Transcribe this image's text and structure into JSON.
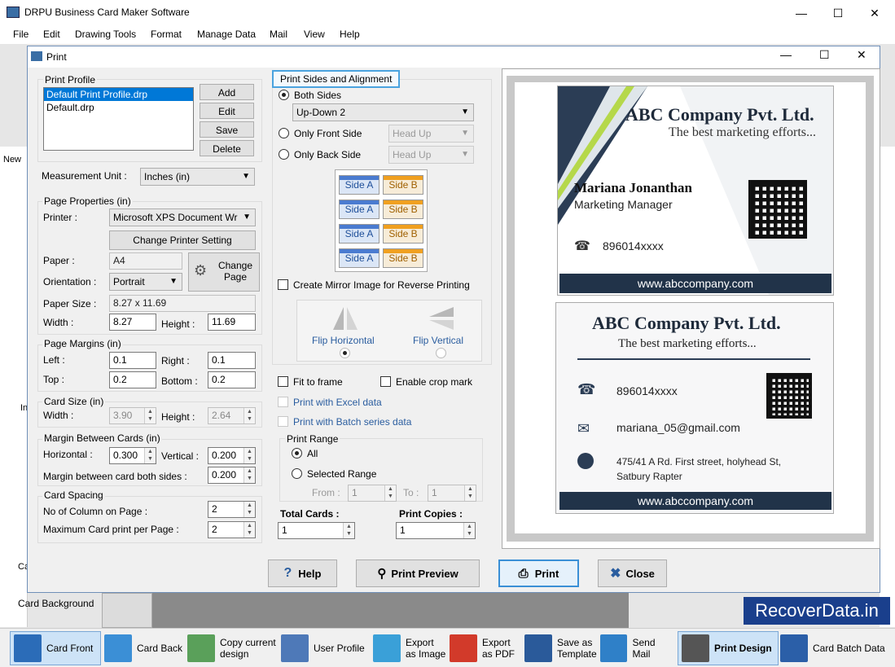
{
  "app": {
    "title": "DRPU Business Card Maker Software"
  },
  "menu": [
    "File",
    "Edit",
    "Drawing Tools",
    "Format",
    "Manage Data",
    "Mail",
    "View",
    "Help"
  ],
  "bg": {
    "new_label": "New",
    "side_in": "In",
    "side_ca": "Ca",
    "card_background": "Card Background"
  },
  "dialog": {
    "title": "Print"
  },
  "print_profile": {
    "legend": "Print Profile",
    "items": [
      "Default Print Profile.drp",
      "Default.drp"
    ],
    "add": "Add",
    "edit": "Edit",
    "save": "Save",
    "delete": "Delete"
  },
  "measurement": {
    "label": "Measurement Unit :",
    "value": "Inches (in)"
  },
  "page_props": {
    "legend": "Page Properties (in)",
    "printer_label": "Printer :",
    "printer_value": "Microsoft XPS Document Wr",
    "change_printer": "Change Printer Setting",
    "paper_label": "Paper :",
    "paper_value": "A4",
    "orientation_label": "Orientation :",
    "orientation_value": "Portrait",
    "change_page": "Change Page",
    "paper_size_label": "Paper Size :",
    "paper_size_value": "8.27 x 11.69",
    "width_label": "Width :",
    "width_value": "8.27",
    "height_label": "Height :",
    "height_value": "11.69"
  },
  "margins": {
    "legend": "Page Margins (in)",
    "left_label": "Left :",
    "left_value": "0.1",
    "right_label": "Right :",
    "right_value": "0.1",
    "top_label": "Top :",
    "top_value": "0.2",
    "bottom_label": "Bottom :",
    "bottom_value": "0.2"
  },
  "card_size": {
    "legend": "Card Size (in)",
    "width_label": "Width :",
    "width_value": "3.90",
    "height_label": "Height :",
    "height_value": "2.64"
  },
  "margin_between": {
    "legend": "Margin Between Cards (in)",
    "horizontal_label": "Horizontal :",
    "horizontal_value": "0.300",
    "vertical_label": "Vertical :",
    "vertical_value": "0.200",
    "both_label": "Margin between card both sides :",
    "both_value": "0.200"
  },
  "spacing": {
    "legend": "Card Spacing",
    "columns_label": "No of Column on Page :",
    "columns_value": "2",
    "max_label": "Maximum Card print per Page :",
    "max_value": "2"
  },
  "sides": {
    "legend": "Print Sides and Alignment",
    "both_label": "Both Sides",
    "both_combo": "Up-Down 2",
    "front_label": "Only Front Side",
    "front_combo": "Head Up",
    "back_label": "Only Back Side",
    "back_combo": "Head Up",
    "side_a": "Side A",
    "side_b": "Side B",
    "mirror_label": "Create Mirror Image for Reverse Printing",
    "flip_h": "Flip Horizontal",
    "flip_v": "Flip Vertical"
  },
  "options": {
    "fit_label": "Fit to frame",
    "crop_label": "Enable crop mark",
    "excel_label": "Print with Excel data",
    "batch_label": "Print with Batch series data"
  },
  "range": {
    "legend": "Print Range",
    "all_label": "All",
    "selected_label": "Selected Range",
    "from_label": "From :",
    "from_value": "1",
    "to_label": "To :",
    "to_value": "1"
  },
  "totals": {
    "cards_label": "Total Cards :",
    "cards_value": "1",
    "copies_label": "Print Copies :",
    "copies_value": "1"
  },
  "card_front": {
    "company": "ABC Company Pvt. Ltd.",
    "tagline": "The best marketing efforts...",
    "name": "Mariana Jonanthan",
    "role": "Marketing Manager",
    "phone": "896014xxxx",
    "website": "www.abccompany.com"
  },
  "card_back": {
    "company": "ABC Company Pvt. Ltd.",
    "tagline": "The best marketing efforts...",
    "phone": "896014xxxx",
    "email": "mariana_05@gmail.com",
    "address1": "475/41 A Rd. First street, holyhead St,",
    "address2": "Satbury Rapter",
    "website": "www.abccompany.com"
  },
  "footer": {
    "help": "Help",
    "preview": "Print Preview",
    "print": "Print",
    "close": "Close"
  },
  "bottom_toolbar": [
    "Card Front",
    "Card Back",
    "Copy current design",
    "User Profile",
    "Export as Image",
    "Export as PDF",
    "Save as Template",
    "Send Mail",
    "Print Design",
    "Card Batch Data"
  ],
  "watermark": "RecoverData.in"
}
